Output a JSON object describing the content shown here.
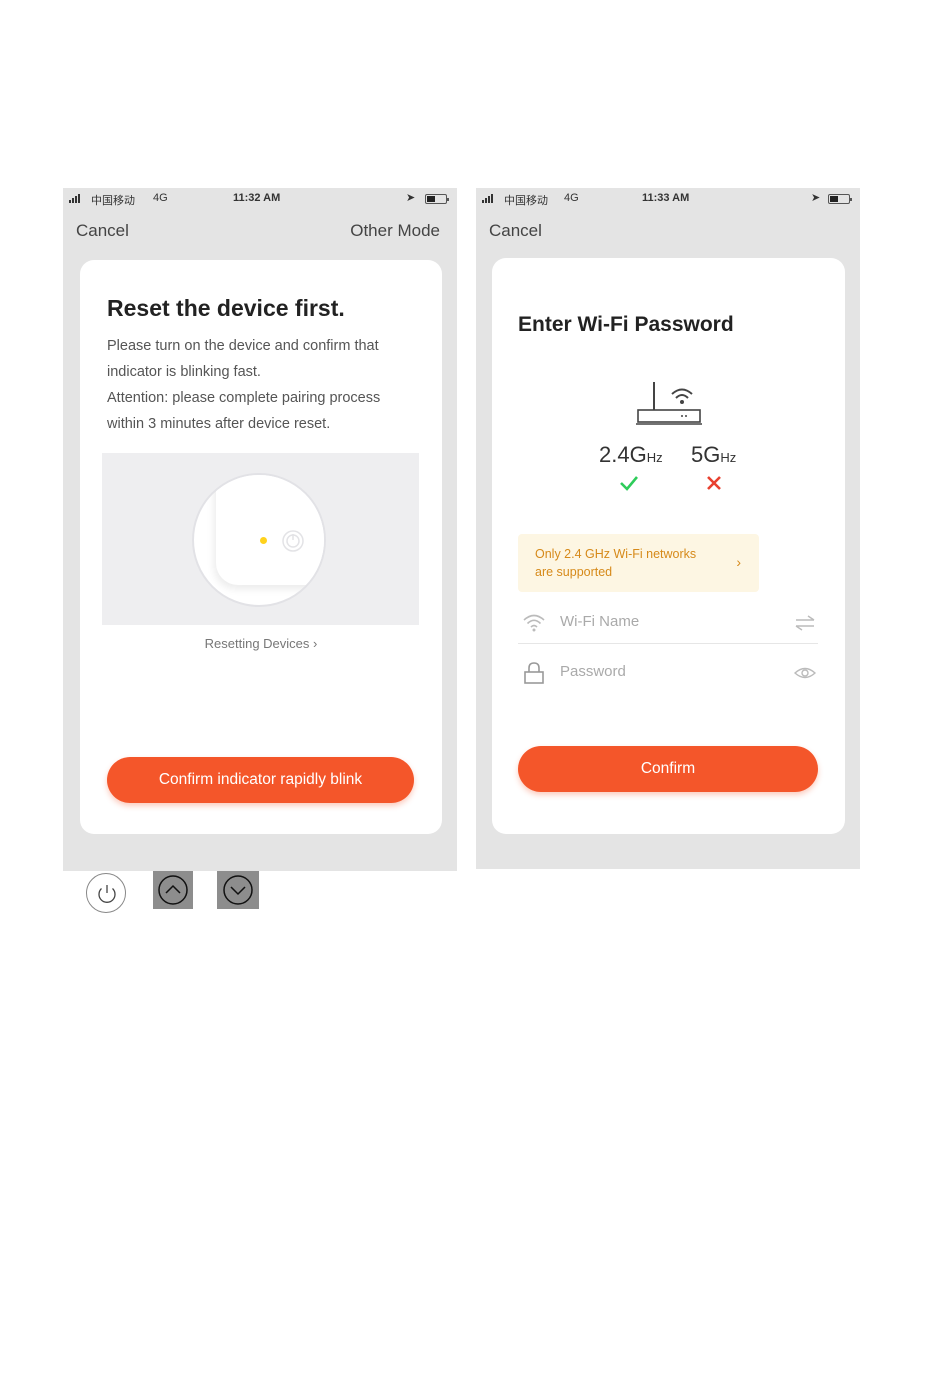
{
  "screen1": {
    "status": {
      "carrier": "中国移动",
      "network": "4G",
      "time": "11:32 AM"
    },
    "nav": {
      "cancel": "Cancel",
      "other_mode": "Other Mode"
    },
    "title": "Reset the device first.",
    "description": [
      "Please turn on the device and confirm that",
      "indicator is blinking fast.",
      "Attention: please complete pairing process",
      "within 3 minutes after device reset."
    ],
    "help_link": "Resetting Devices ›",
    "confirm_button": "Confirm indicator rapidly blink"
  },
  "screen2": {
    "status": {
      "carrier": "中国移动",
      "network": "4G",
      "time": "11:33 AM"
    },
    "nav": {
      "cancel": "Cancel"
    },
    "title": "Enter Wi-Fi Password",
    "band_24": {
      "value": "2.4G",
      "unit": "Hz",
      "supported": true
    },
    "band_5": {
      "value": "5G",
      "unit": "Hz",
      "supported": false
    },
    "notice": {
      "line1": "Only 2.4 GHz Wi-Fi networks",
      "line2": "are supported"
    },
    "wifi_name_placeholder": "Wi-Fi Name",
    "password_placeholder": "Password",
    "confirm_button": "Confirm"
  },
  "colors": {
    "accent": "#f4562a",
    "phone_bg": "#e4e4e4",
    "notice_text": "#d68a1a",
    "check": "#2ecc5a",
    "cross": "#e8402f"
  },
  "icons": {
    "bottom_row": [
      "power-icon",
      "chevron-up-icon",
      "chevron-down-icon"
    ]
  }
}
